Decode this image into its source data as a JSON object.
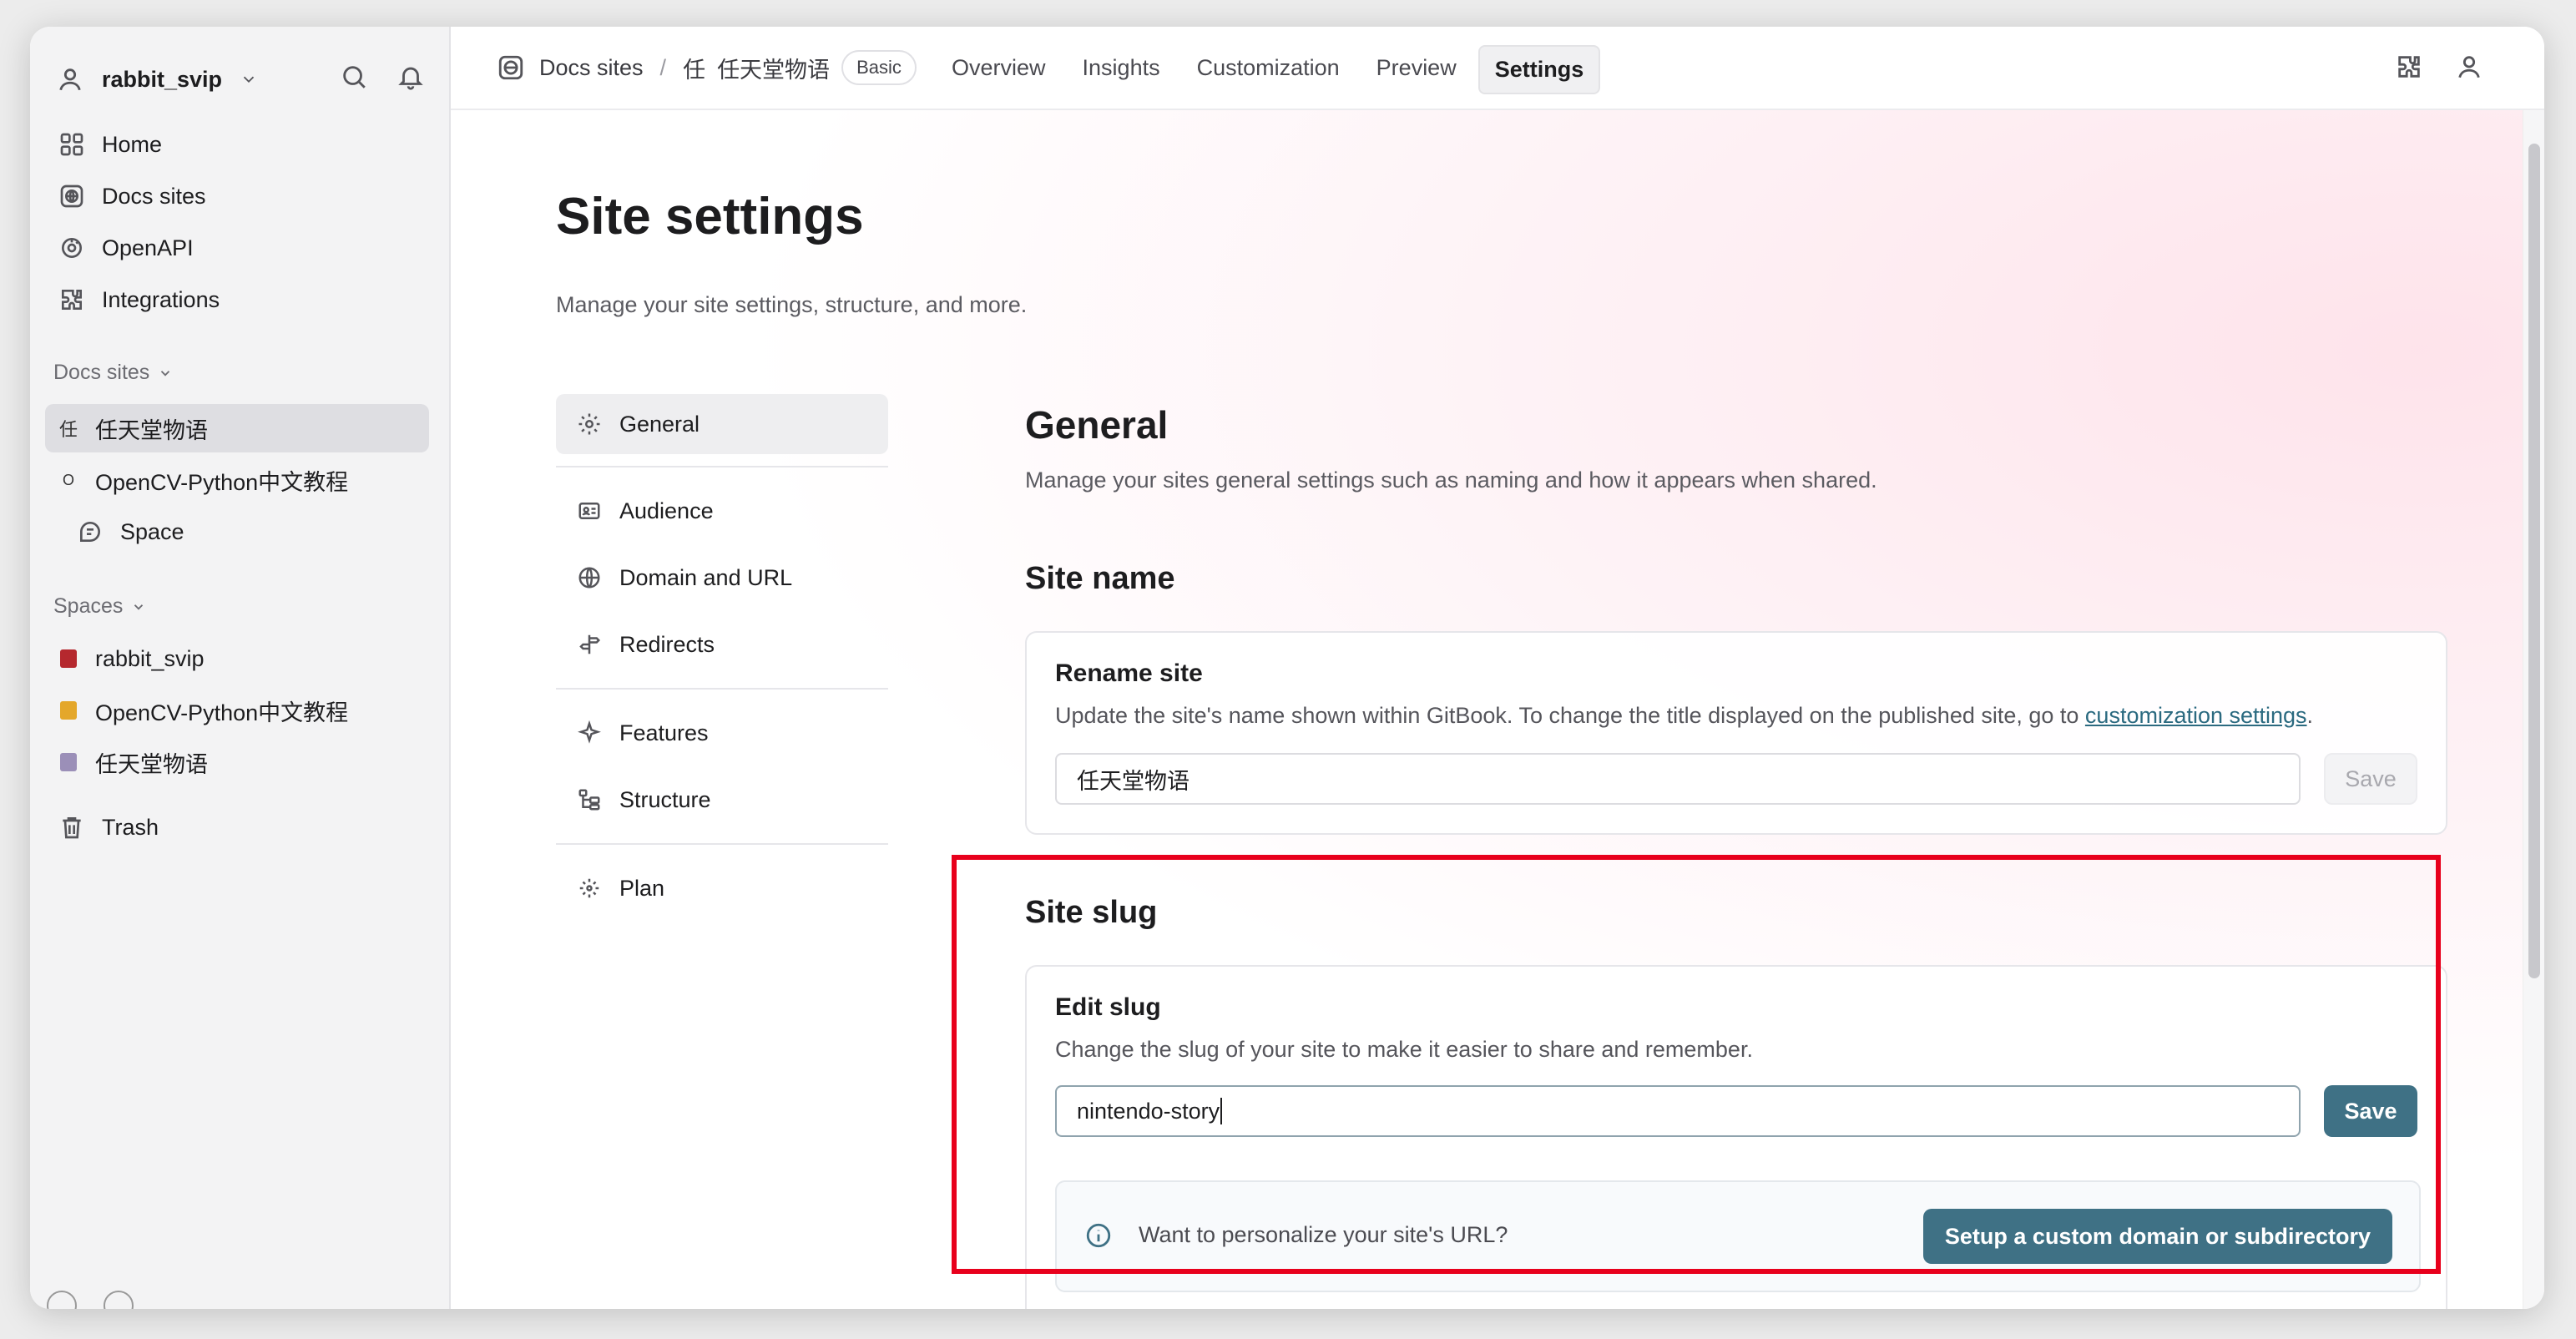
{
  "sidebar": {
    "account_name": "rabbit_svip",
    "nav": [
      {
        "label": "Home",
        "icon": "grid-icon"
      },
      {
        "label": "Docs sites",
        "icon": "globe-icon"
      },
      {
        "label": "OpenAPI",
        "icon": "openapi-icon"
      },
      {
        "label": "Integrations",
        "icon": "puzzle-icon"
      }
    ],
    "docs_sites_header": "Docs sites",
    "docs_sites": [
      {
        "glyph": "任",
        "label": "任天堂物语"
      },
      {
        "glyph": "O",
        "label": "OpenCV-Python中文教程"
      },
      {
        "glyph": "",
        "label": "Space"
      }
    ],
    "spaces_header": "Spaces",
    "spaces": [
      {
        "label": "rabbit_svip",
        "color": "#b5282e"
      },
      {
        "label": "OpenCV-Python中文教程",
        "color": "#e4a72a"
      },
      {
        "label": "任天堂物语",
        "color": "#9b8fb8"
      }
    ],
    "trash": "Trash"
  },
  "topbar": {
    "crumb_root": "Docs sites",
    "crumb_sep": "/",
    "site_glyph": "任",
    "site_name": "任天堂物语",
    "plan_badge": "Basic",
    "tabs": [
      "Overview",
      "Insights",
      "Customization",
      "Preview",
      "Settings"
    ],
    "active_tab": "Settings"
  },
  "page": {
    "title": "Site settings",
    "subtitle": "Manage your site settings, structure, and more."
  },
  "settings_nav": [
    {
      "label": "General",
      "icon": "gear-icon"
    },
    {
      "label": "Audience",
      "icon": "audience-icon"
    },
    {
      "label": "Domain and URL",
      "icon": "globe-icon"
    },
    {
      "label": "Redirects",
      "icon": "signpost-icon"
    },
    {
      "label": "Features",
      "icon": "sparkle-icon"
    },
    {
      "label": "Structure",
      "icon": "tree-icon"
    },
    {
      "label": "Plan",
      "icon": "plan-icon"
    }
  ],
  "general": {
    "title": "General",
    "subtitle": "Manage your sites general settings such as naming and how it appears when shared.",
    "site_name_heading": "Site name",
    "rename": {
      "title": "Rename site",
      "desc": "Update the site's name shown within GitBook. To change the title displayed on the published site, go to ",
      "link": "customization settings",
      "desc_end": ".",
      "value": "任天堂物语",
      "save": "Save"
    },
    "slug_heading": "Site slug",
    "slug": {
      "title": "Edit slug",
      "desc": "Change the slug of your site to make it easier to share and remember.",
      "value": "nintendo-story",
      "save": "Save",
      "callout_text": "Want to personalize your site's URL?",
      "callout_button": "Setup a custom domain or subdirectory"
    }
  },
  "colors": {
    "accent": "#3f7185",
    "highlight": "#e8001c"
  }
}
